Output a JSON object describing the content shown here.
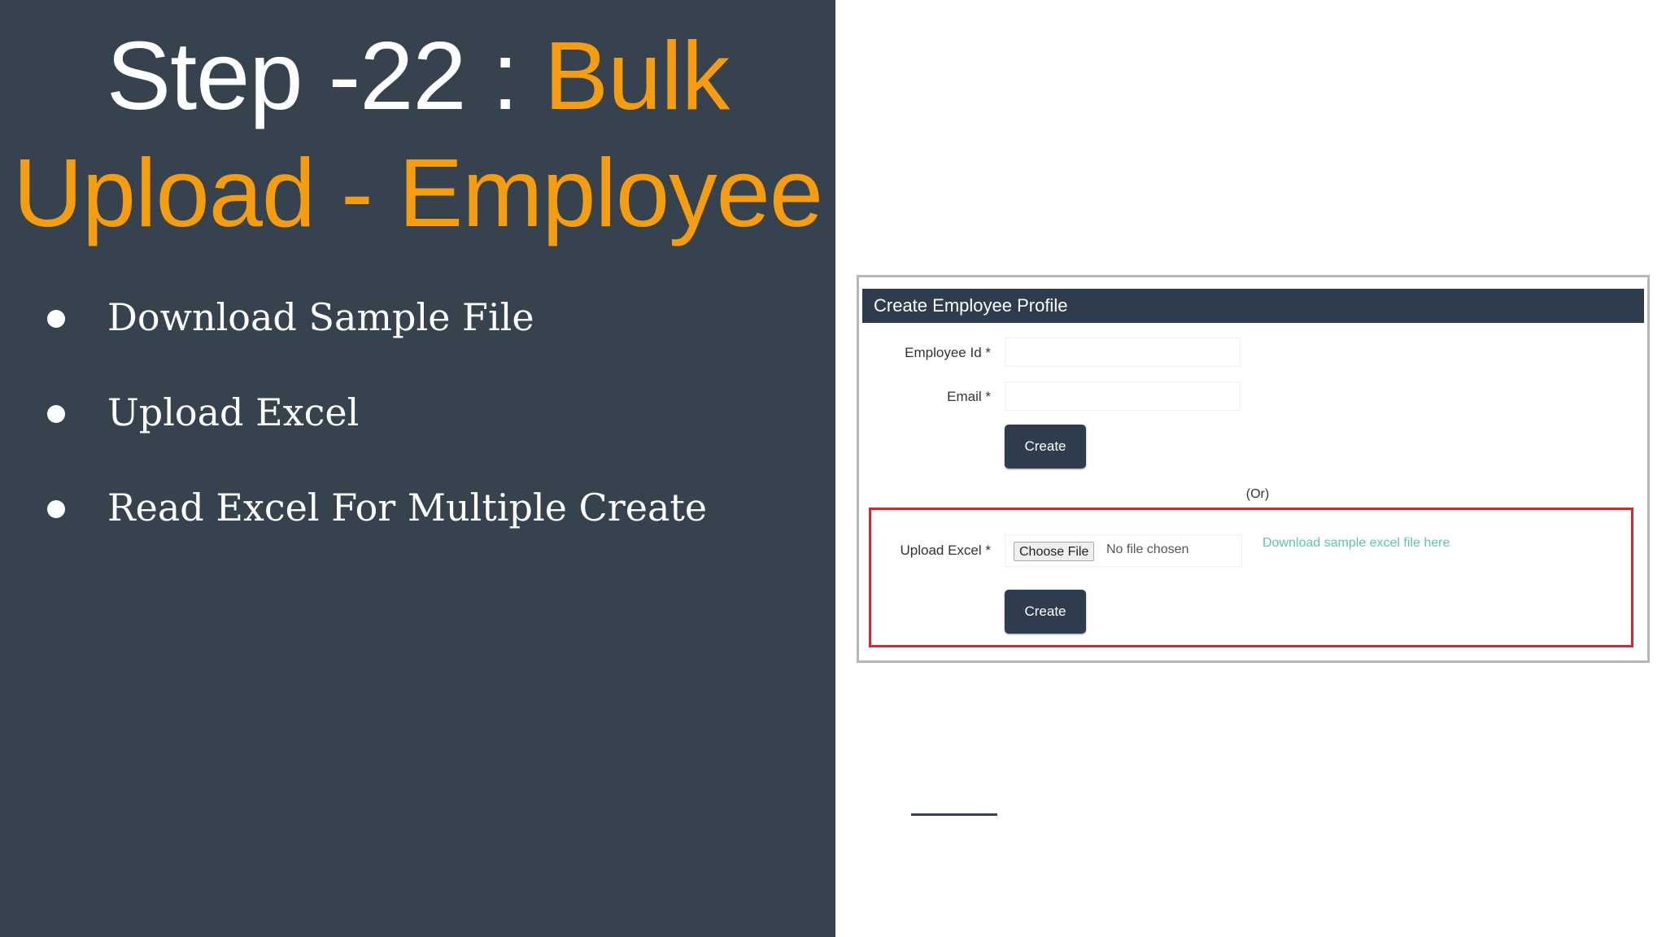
{
  "slide": {
    "title_prefix": "Step -22 : ",
    "title_accent": "Bulk Upload - Employee",
    "bullets": [
      "Download Sample File",
      "Upload Excel",
      "Read Excel For Multiple Create"
    ]
  },
  "form": {
    "header": "Create Employee Profile",
    "employee_id_label": "Employee Id *",
    "email_label": "Email *",
    "create_label": "Create",
    "or_label": "(Or)",
    "upload_label": "Upload Excel *",
    "choose_file_label": "Choose File",
    "no_file_text": "No file chosen",
    "download_link": "Download sample excel file here",
    "upload_create_label": "Create"
  },
  "colors": {
    "panel": "#36434e",
    "accent": "#f59d0f",
    "header": "#2e3c4d",
    "highlight": "#d7262f",
    "link": "#5cc8a0"
  }
}
